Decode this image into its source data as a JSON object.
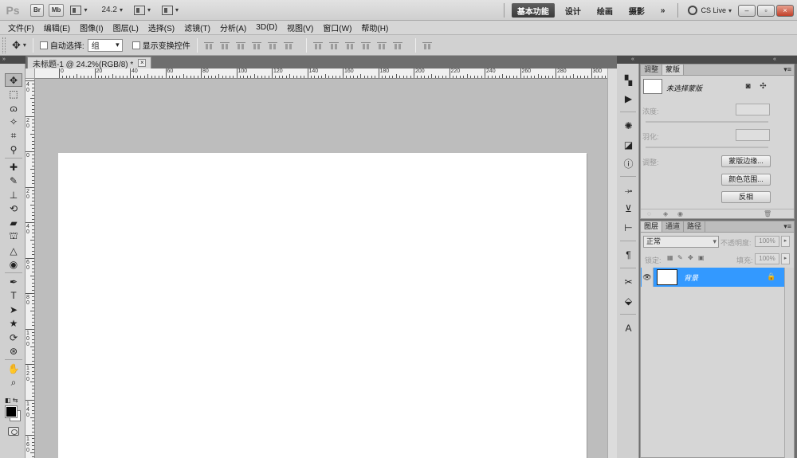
{
  "titlebar": {
    "logo": "Ps",
    "br_label": "Br",
    "mb_label": "Mb",
    "zoom": "24.2",
    "workspaces": [
      {
        "label": "基本功能",
        "active": true
      },
      {
        "label": "设计",
        "active": false
      },
      {
        "label": "绘画",
        "active": false
      },
      {
        "label": "摄影",
        "active": false
      }
    ],
    "more": "»",
    "cs_live": "CS Live",
    "win_min": "–",
    "win_max": "▫",
    "win_close": "×"
  },
  "menu": [
    "文件(F)",
    "编辑(E)",
    "图像(I)",
    "图层(L)",
    "选择(S)",
    "滤镜(T)",
    "分析(A)",
    "3D(D)",
    "视图(V)",
    "窗口(W)",
    "帮助(H)"
  ],
  "options": {
    "auto_select_label": "自动选择:",
    "auto_select_value": "组",
    "transform_label": "显示变换控件"
  },
  "document": {
    "tab_title": "未标题-1 @ 24.2%(RGB/8) *",
    "close": "×"
  },
  "rulers": {
    "h_labels": [
      "0",
      "20",
      "40",
      "60",
      "80",
      "100",
      "120",
      "140",
      "160",
      "180",
      "200",
      "220",
      "240",
      "260",
      "280",
      "300"
    ],
    "v_labels": [
      "40",
      "20",
      "0",
      "20",
      "40",
      "60",
      "80",
      "100",
      "120",
      "140",
      "160"
    ]
  },
  "tools": [
    {
      "name": "move-tool",
      "glyph": "✥",
      "active": true
    },
    {
      "name": "marquee-tool",
      "glyph": "⬚"
    },
    {
      "name": "lasso-tool",
      "glyph": "ɷ"
    },
    {
      "name": "quick-select-tool",
      "glyph": "✧"
    },
    {
      "name": "crop-tool",
      "glyph": "⌗"
    },
    {
      "name": "eyedropper-tool",
      "glyph": "⚲"
    },
    {
      "name": "healing-tool",
      "glyph": "✚"
    },
    {
      "name": "brush-tool",
      "glyph": "✎"
    },
    {
      "name": "stamp-tool",
      "glyph": "⊥"
    },
    {
      "name": "history-brush-tool",
      "glyph": "⟲"
    },
    {
      "name": "eraser-tool",
      "glyph": "▰"
    },
    {
      "name": "paint-bucket-tool",
      "glyph": "⛫"
    },
    {
      "name": "blur-tool",
      "glyph": "△"
    },
    {
      "name": "dodge-tool",
      "glyph": "◉"
    },
    {
      "name": "pen-tool",
      "glyph": "✒"
    },
    {
      "name": "type-tool",
      "glyph": "T"
    },
    {
      "name": "path-select-tool",
      "glyph": "➤"
    },
    {
      "name": "shape-tool",
      "glyph": "★"
    },
    {
      "name": "3d-rotate-tool",
      "glyph": "⟳"
    },
    {
      "name": "3d-orbit-tool",
      "glyph": "⊛"
    },
    {
      "name": "hand-tool",
      "glyph": "✋"
    },
    {
      "name": "zoom-tool",
      "glyph": "⌕"
    }
  ],
  "dock_icons": [
    {
      "name": "adjustments-icon",
      "glyph": "▚"
    },
    {
      "name": "actions-icon",
      "glyph": "▶"
    },
    {
      "name": "navigator-icon",
      "glyph": "✺"
    },
    {
      "name": "histogram-icon",
      "glyph": "◪"
    },
    {
      "name": "info-icon",
      "glyph": "ⓘ"
    },
    {
      "name": "brush-presets-icon",
      "glyph": "⤞"
    },
    {
      "name": "clone-source-icon",
      "glyph": "⊻"
    },
    {
      "name": "tool-presets-icon",
      "glyph": "⊢"
    },
    {
      "name": "paragraph-icon",
      "glyph": "¶"
    },
    {
      "name": "tools-panel-icon",
      "glyph": "✂"
    },
    {
      "name": "3d-panel-icon",
      "glyph": "⬙"
    },
    {
      "name": "character-icon",
      "glyph": "A"
    }
  ],
  "mask_panel": {
    "tabs": [
      {
        "label": "调整",
        "active": false
      },
      {
        "label": "蒙版",
        "active": true
      }
    ],
    "title": "未选择蒙版",
    "density_label": "浓度:",
    "feather_label": "羽化:",
    "refine_label": "调整:",
    "btn_mask_edge": "蒙版边缘...",
    "btn_color_range": "颜色范围...",
    "btn_invert": "反相"
  },
  "layers_panel": {
    "tabs": [
      {
        "label": "图层",
        "active": true
      },
      {
        "label": "通道",
        "active": false
      },
      {
        "label": "路径",
        "active": false
      }
    ],
    "blend_mode": "正常",
    "opacity_label": "不透明度:",
    "opacity_value": "100%",
    "lock_label": "锁定:",
    "fill_label": "填充:",
    "fill_value": "100%",
    "layer_name": "背景"
  }
}
